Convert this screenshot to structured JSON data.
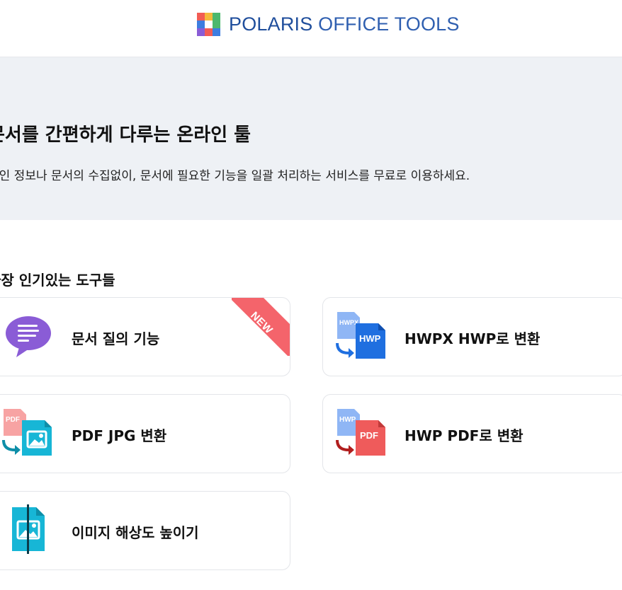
{
  "header": {
    "logo_text_bold": "POLARIS",
    "logo_text_light": "OFFICE TOOLS",
    "logo_colors": [
      "#f25c54",
      "#f6b93b",
      "#4cb86d",
      "#3d7de0",
      "#8a5cd6",
      "#f25c54",
      "#3d7de0",
      "#f6b93b",
      "#4cb86d"
    ]
  },
  "hero": {
    "title": "문서를 간편하게 다루는 온라인 툴",
    "subtitle": "개인 정보나 문서의 수집없이, 문서에 필요한 기능을 일괄 처리하는 서비스를 무료로 이용하세요."
  },
  "popular": {
    "title": "가장 인기있는 도구들",
    "tools": [
      {
        "label": "문서 질의 기능",
        "icon": "chat-bubble-icon",
        "badge": "NEW",
        "color": "#8a5cd6"
      },
      {
        "label": "HWPX HWP로 변환",
        "icon": "hwp-convert-icon",
        "badge": "",
        "color": "#1f6fe0"
      },
      {
        "label": "PDF JPG 변환",
        "icon": "pdf-to-image-icon",
        "badge": "",
        "color": "#17b6d6"
      },
      {
        "label": "HWP PDF로 변환",
        "icon": "hwp-to-pdf-icon",
        "badge": "",
        "color": "#ef5b5b"
      },
      {
        "label": "이미지 해상도 높이기",
        "icon": "image-upscale-icon",
        "badge": "",
        "color": "#17b6d6"
      }
    ]
  }
}
